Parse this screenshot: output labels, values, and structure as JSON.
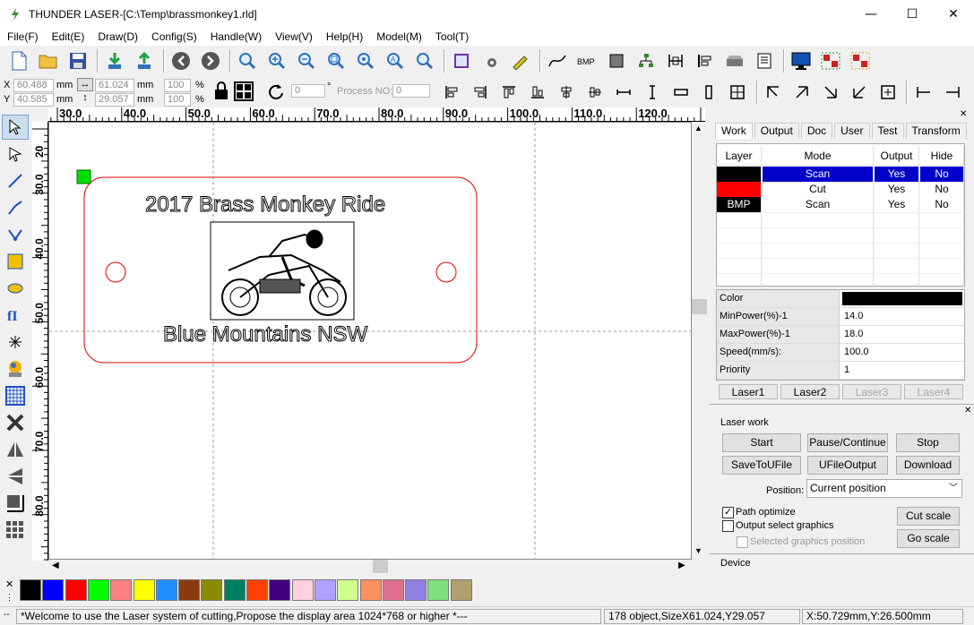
{
  "window": {
    "title": "THUNDER LASER-[C:\\Temp\\brassmonkey1.rld]",
    "min": "—",
    "max": "☐",
    "close": "✕"
  },
  "menu": [
    "File(F)",
    "Edit(E)",
    "Draw(D)",
    "Config(S)",
    "Handle(W)",
    "View(V)",
    "Help(H)",
    "Model(M)",
    "Tool(T)"
  ],
  "coords": {
    "x_label": "X",
    "x_value": "60.488",
    "x_unit": "mm",
    "y_label": "Y",
    "y_value": "40.585",
    "y_unit": "mm",
    "w_value": "61.024",
    "w_unit": "mm",
    "h_value": "29.057",
    "h_unit": "mm",
    "sx_value": "100",
    "sx_unit": "%",
    "sy_value": "100",
    "sy_unit": "%",
    "rotate_value": "0",
    "degree": "°",
    "process_label": "Process NO:",
    "process_value": "0"
  },
  "ruler_top": [
    "30.0",
    "40.0",
    "50.0",
    "60.0",
    "70.0",
    "80.0",
    "90.0",
    "100.0",
    "110.0",
    "120.0"
  ],
  "ruler_left": [
    "20",
    "30.0",
    "40.0",
    "50.0",
    "60.0",
    "70.0",
    "80.0"
  ],
  "design": {
    "title_text": "2017 Brass Monkey Ride",
    "bottom_text": "Blue Mountains NSW"
  },
  "palette": [
    "#000000",
    "#0000ff",
    "#ff0000",
    "#00ff00",
    "#ff8080",
    "#ffff00",
    "#1e90ff",
    "#8b3a0f",
    "#8b8b00",
    "#008060",
    "#ff4000",
    "#400080",
    "#ffd0e0",
    "#b0a0ff",
    "#d0ff90",
    "#ff9060",
    "#e07090",
    "#9080e0",
    "#80e080",
    "#b0a070"
  ],
  "status": {
    "message": "*Welcome to use the Laser system of cutting,Propose the display area 1024*768 or higher *---",
    "objects": "178 object,SizeX61.024,Y29.057",
    "position": "X:50.729mm,Y:26.500mm"
  },
  "panel": {
    "tabs": [
      "Work",
      "Output",
      "Doc",
      "User",
      "Test",
      "Transform"
    ],
    "layer_headers": [
      "Layer",
      "Mode",
      "Output",
      "Hide"
    ],
    "layers": [
      {
        "layer": "",
        "color": "#000000",
        "mode": "Scan",
        "output": "Yes",
        "hide": "No",
        "selected": true
      },
      {
        "layer": "",
        "color": "#ff0000",
        "mode": "Cut",
        "output": "Yes",
        "hide": "No",
        "selected": false
      },
      {
        "layer": "BMP",
        "color": "#000000",
        "mode": "Scan",
        "output": "Yes",
        "hide": "No",
        "selected": false
      }
    ],
    "props": [
      {
        "key": "Color",
        "value": ""
      },
      {
        "key": "MinPower(%)-1",
        "value": "14.0"
      },
      {
        "key": "MaxPower(%)-1",
        "value": "18.0"
      },
      {
        "key": "Speed(mm/s):",
        "value": "100.0"
      },
      {
        "key": "Priority",
        "value": "1"
      }
    ],
    "laser_tabs": [
      "Laser1",
      "Laser2",
      "Laser3",
      "Laser4"
    ],
    "laser_work_title": "Laser work",
    "buttons": {
      "start": "Start",
      "pause": "Pause/Continue",
      "stop": "Stop",
      "save_u": "SaveToUFile",
      "ufile_out": "UFileOutput",
      "download": "Download",
      "cut_scale": "Cut scale",
      "go_scale": "Go scale"
    },
    "position_label": "Position:",
    "position_value": "Current position",
    "path_optimize": "Path optimize",
    "output_select": "Output select graphics",
    "selected_pos": "Selected graphics position",
    "device": "Device"
  }
}
